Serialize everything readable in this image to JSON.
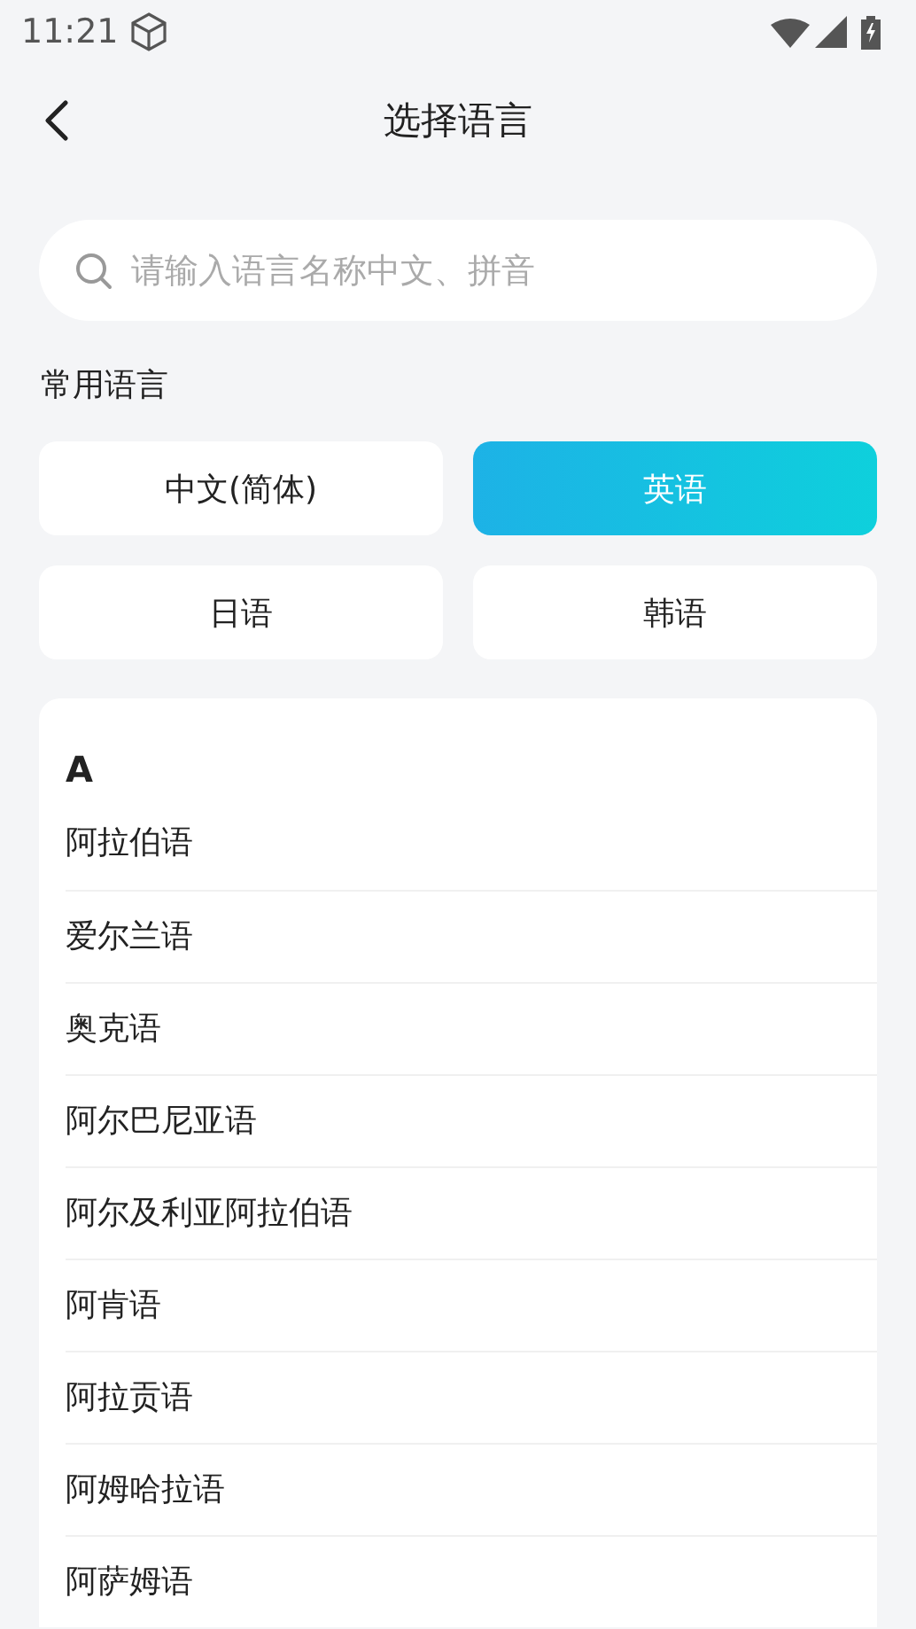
{
  "status_bar": {
    "time": "11:21"
  },
  "header": {
    "title": "选择语言"
  },
  "search": {
    "placeholder": "请输入语言名称中文、拼音"
  },
  "common": {
    "title": "常用语言",
    "items": [
      {
        "label": "中文(简体)",
        "selected": false
      },
      {
        "label": "英语",
        "selected": true
      },
      {
        "label": "日语",
        "selected": false
      },
      {
        "label": "韩语",
        "selected": false
      }
    ]
  },
  "list": {
    "sections": [
      {
        "letter": "A",
        "items": [
          "阿拉伯语",
          "爱尔兰语",
          "奥克语",
          "阿尔巴尼亚语",
          "阿尔及利亚阿拉伯语",
          "阿肯语",
          "阿拉贡语",
          "阿姆哈拉语",
          "阿萨姆语"
        ]
      }
    ]
  }
}
